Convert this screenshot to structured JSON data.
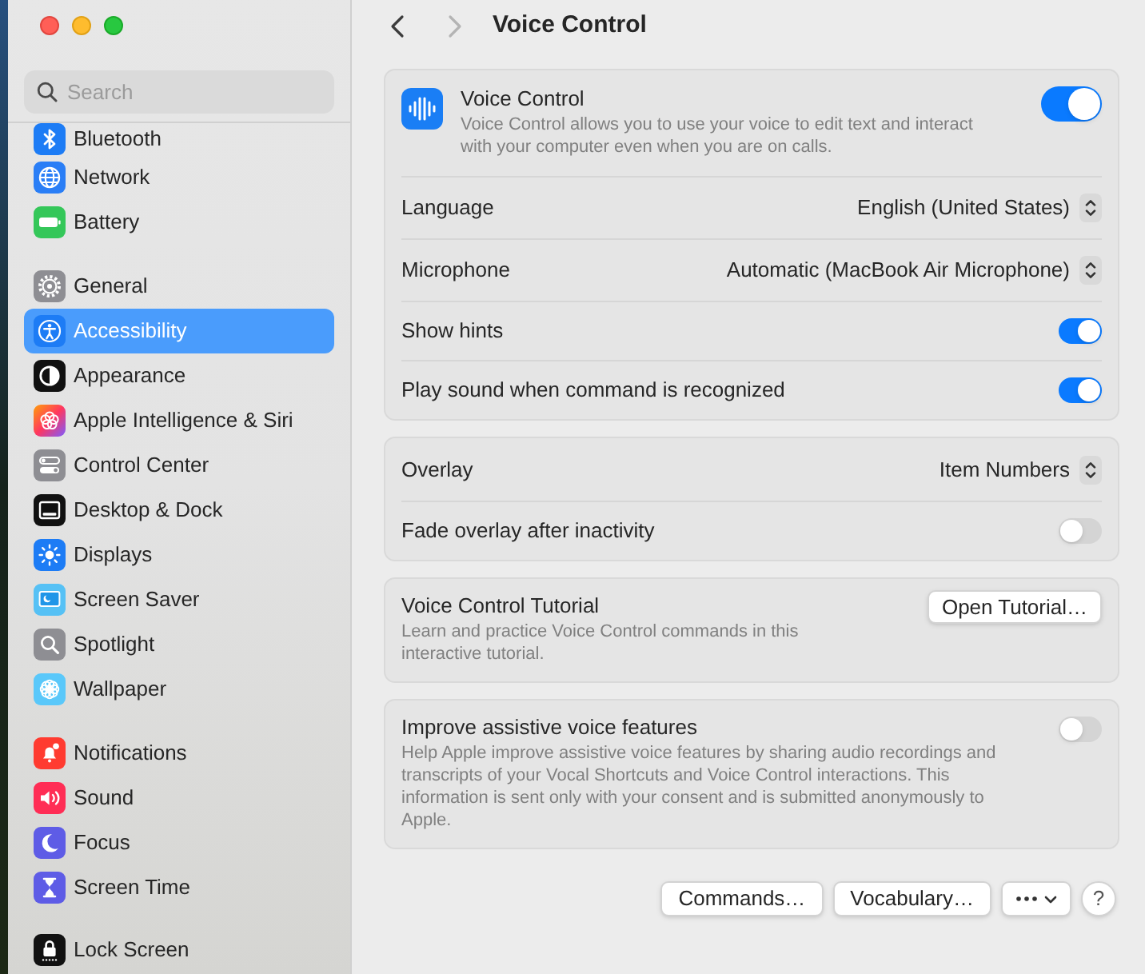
{
  "window": {
    "title": "Voice Control"
  },
  "toolbar": {
    "back": {
      "disabled": false
    },
    "forward": {
      "disabled": true
    }
  },
  "sidebar": {
    "search": {
      "placeholder": "Search"
    },
    "groups": [
      {
        "items": [
          {
            "label": "Bluetooth",
            "selected": false
          },
          {
            "label": "Network",
            "selected": false
          },
          {
            "label": "Battery",
            "selected": false
          }
        ]
      },
      {
        "items": [
          {
            "label": "General",
            "selected": false
          },
          {
            "label": "Accessibility",
            "selected": true
          },
          {
            "label": "Appearance",
            "selected": false
          },
          {
            "label": "Apple Intelligence & Siri",
            "selected": false
          },
          {
            "label": "Control Center",
            "selected": false
          },
          {
            "label": "Desktop & Dock",
            "selected": false
          },
          {
            "label": "Displays",
            "selected": false
          },
          {
            "label": "Screen Saver",
            "selected": false
          },
          {
            "label": "Spotlight",
            "selected": false
          },
          {
            "label": "Wallpaper",
            "selected": false
          }
        ]
      },
      {
        "items": [
          {
            "label": "Notifications",
            "selected": false
          },
          {
            "label": "Sound",
            "selected": false
          },
          {
            "label": "Focus",
            "selected": false
          },
          {
            "label": "Screen Time",
            "selected": false
          }
        ]
      },
      {
        "items": [
          {
            "label": "Lock Screen",
            "selected": false
          }
        ]
      }
    ]
  },
  "sections": [
    {
      "rows": [
        {
          "kind": "header",
          "title": "Voice Control",
          "description": "Voice Control allows you to use your voice to edit text and interact with your computer even when you are on calls.",
          "on": true
        },
        {
          "kind": "popup",
          "label": "Language",
          "value": "English (United States)"
        },
        {
          "kind": "popup",
          "label": "Microphone",
          "value": "Automatic (MacBook Air Microphone)"
        },
        {
          "kind": "toggle",
          "label": "Show hints",
          "on": true
        },
        {
          "kind": "toggle",
          "label": "Play sound when command is recognized",
          "on": true
        }
      ]
    },
    {
      "rows": [
        {
          "kind": "popup",
          "label": "Overlay",
          "value": "Item Numbers"
        },
        {
          "kind": "toggle",
          "label": "Fade overlay after inactivity",
          "on": false
        }
      ]
    },
    {
      "rows": [
        {
          "kind": "action",
          "title": "Voice Control Tutorial",
          "description": "Learn and practice Voice Control commands in this interactive tutorial.",
          "button": "Open Tutorial…"
        }
      ]
    },
    {
      "rows": [
        {
          "kind": "described_toggle",
          "title": "Improve assistive voice features",
          "description": "Help Apple improve assistive voice features by sharing audio recordings and transcripts of your Vocal Shortcuts and Voice Control interactions. This information is sent only with your consent and is submitted anonymously to Apple.",
          "on": false
        }
      ]
    }
  ],
  "footer_buttons": [
    {
      "kind": "button",
      "label": "Commands…"
    },
    {
      "kind": "button",
      "label": "Vocabulary…"
    },
    {
      "kind": "action_menu"
    },
    {
      "kind": "help",
      "label": "?"
    }
  ]
}
